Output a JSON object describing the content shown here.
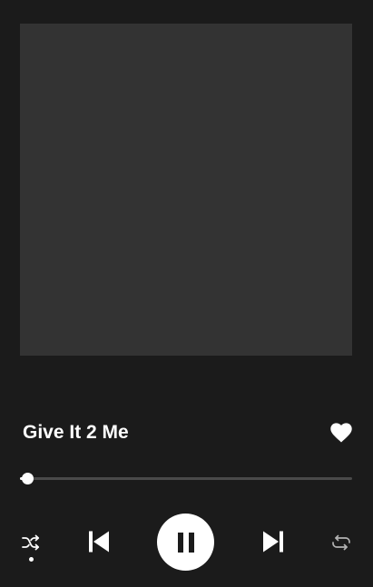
{
  "player": {
    "track_title": "Give It 2 Me",
    "liked": true,
    "progress_fraction": 0.023,
    "shuffle_enabled": true,
    "is_playing": true
  },
  "icons": {
    "like": "heart-icon",
    "shuffle": "shuffle-icon",
    "previous": "skip-previous-icon",
    "play_pause": "pause-icon",
    "next": "skip-next-icon",
    "repeat": "repeat-icon"
  },
  "colors": {
    "background": "#1b1b1b",
    "album_placeholder": "#333333",
    "progress_track": "#4a4a4a",
    "foreground": "#ffffff",
    "repeat_inactive": "#b3b3b3"
  }
}
